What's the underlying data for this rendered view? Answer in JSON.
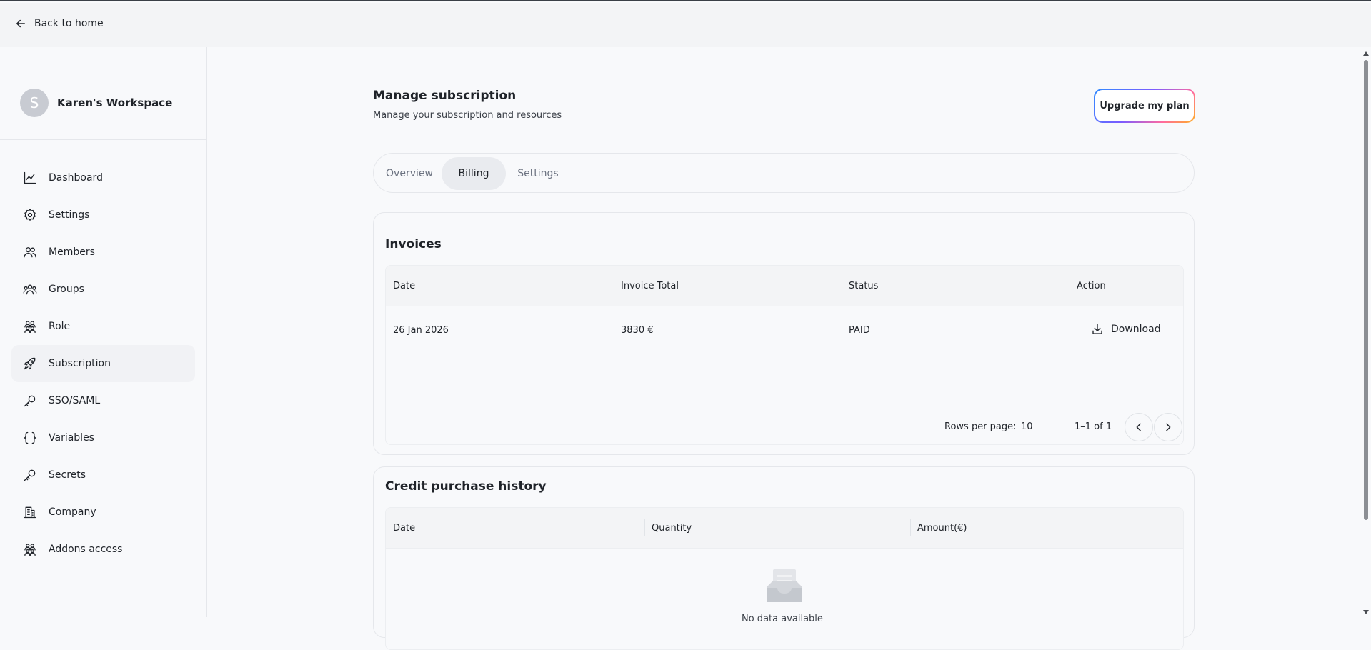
{
  "topbar": {
    "back_label": "Back to home"
  },
  "workspace": {
    "avatar_letter": "S",
    "name": "Karen's Workspace"
  },
  "sidebar": {
    "items": [
      {
        "label": "Dashboard",
        "icon": "chart-line-icon"
      },
      {
        "label": "Settings",
        "icon": "gear-icon"
      },
      {
        "label": "Members",
        "icon": "users-icon"
      },
      {
        "label": "Groups",
        "icon": "group-icon"
      },
      {
        "label": "Role",
        "icon": "role-icon"
      },
      {
        "label": "Subscription",
        "icon": "rocket-icon",
        "active": true
      },
      {
        "label": "SSO/SAML",
        "icon": "key-icon"
      },
      {
        "label": "Variables",
        "icon": "braces-icon"
      },
      {
        "label": "Secrets",
        "icon": "key-icon"
      },
      {
        "label": "Company",
        "icon": "building-icon"
      },
      {
        "label": "Addons access",
        "icon": "addons-icon"
      }
    ]
  },
  "header": {
    "title": "Manage subscription",
    "subtitle": "Manage your subscription and resources",
    "upgrade_label": "Upgrade my plan"
  },
  "tabs": [
    {
      "label": "Overview",
      "active": false
    },
    {
      "label": "Billing",
      "active": true
    },
    {
      "label": "Settings",
      "active": false
    }
  ],
  "invoices": {
    "title": "Invoices",
    "columns": [
      "Date",
      "Invoice Total",
      "Status",
      "Action"
    ],
    "rows": [
      {
        "date": "26 Jan 2026",
        "total": "3830 €",
        "status": "PAID",
        "action": "Download"
      }
    ],
    "rows_per_page_label": "Rows per page:",
    "rows_per_page": "10",
    "range": "1–1 of 1"
  },
  "credits": {
    "title": "Credit purchase history",
    "columns": [
      "Date",
      "Quantity",
      "Amount(€)"
    ],
    "empty_text": "No data available"
  }
}
